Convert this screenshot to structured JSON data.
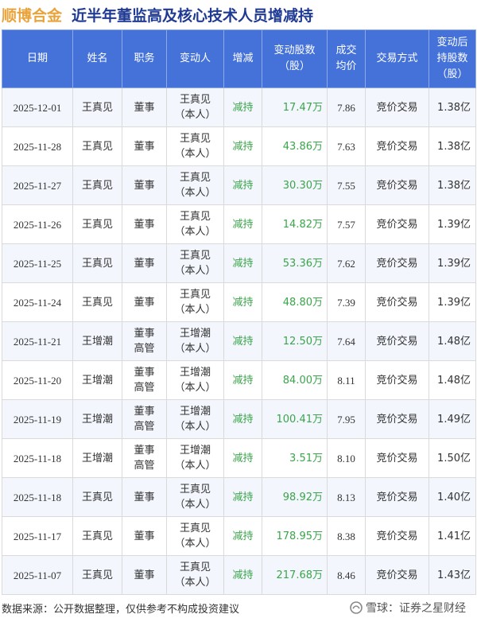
{
  "header": {
    "company": "顺博合金",
    "subject": "近半年董监高及核心技术人员增减持"
  },
  "table": {
    "columns": [
      "日期",
      "姓名",
      "职务",
      "变动人",
      "增减",
      "变动股数\n（股）",
      "成交\n均价",
      "交易方式",
      "变动后\n持股数\n（股）"
    ],
    "rows": [
      {
        "date": "2025-12-01",
        "name": "王真见",
        "role": "董事",
        "person": "王真见\n（本人）",
        "type": "减持",
        "shares": "17.47万",
        "price": "7.86",
        "method": "竞价交易",
        "balance": "1.38亿"
      },
      {
        "date": "2025-11-28",
        "name": "王真见",
        "role": "董事",
        "person": "王真见\n（本人）",
        "type": "减持",
        "shares": "43.86万",
        "price": "7.63",
        "method": "竞价交易",
        "balance": "1.38亿"
      },
      {
        "date": "2025-11-27",
        "name": "王真见",
        "role": "董事",
        "person": "王真见\n（本人）",
        "type": "减持",
        "shares": "30.30万",
        "price": "7.55",
        "method": "竞价交易",
        "balance": "1.38亿"
      },
      {
        "date": "2025-11-26",
        "name": "王真见",
        "role": "董事",
        "person": "王真见\n（本人）",
        "type": "减持",
        "shares": "14.82万",
        "price": "7.57",
        "method": "竞价交易",
        "balance": "1.39亿"
      },
      {
        "date": "2025-11-25",
        "name": "王真见",
        "role": "董事",
        "person": "王真见\n（本人）",
        "type": "减持",
        "shares": "53.36万",
        "price": "7.62",
        "method": "竞价交易",
        "balance": "1.39亿"
      },
      {
        "date": "2025-11-24",
        "name": "王真见",
        "role": "董事",
        "person": "王真见\n（本人）",
        "type": "减持",
        "shares": "48.80万",
        "price": "7.39",
        "method": "竞价交易",
        "balance": "1.39亿"
      },
      {
        "date": "2025-11-21",
        "name": "王增潮",
        "role": "董事\n高管",
        "person": "王增潮\n（本人）",
        "type": "减持",
        "shares": "12.50万",
        "price": "7.64",
        "method": "竞价交易",
        "balance": "1.48亿"
      },
      {
        "date": "2025-11-20",
        "name": "王增潮",
        "role": "董事\n高管",
        "person": "王增潮\n（本人）",
        "type": "减持",
        "shares": "84.00万",
        "price": "8.11",
        "method": "竞价交易",
        "balance": "1.48亿"
      },
      {
        "date": "2025-11-19",
        "name": "王增潮",
        "role": "董事\n高管",
        "person": "王增潮\n（本人）",
        "type": "减持",
        "shares": "100.41万",
        "price": "7.95",
        "method": "竞价交易",
        "balance": "1.49亿"
      },
      {
        "date": "2025-11-18",
        "name": "王增潮",
        "role": "董事\n高管",
        "person": "王增潮\n（本人）",
        "type": "减持",
        "shares": "3.51万",
        "price": "8.10",
        "method": "竞价交易",
        "balance": "1.50亿"
      },
      {
        "date": "2025-11-18",
        "name": "王真见",
        "role": "董事",
        "person": "王真见\n（本人）",
        "type": "减持",
        "shares": "98.92万",
        "price": "8.13",
        "method": "竞价交易",
        "balance": "1.40亿"
      },
      {
        "date": "2025-11-17",
        "name": "王真见",
        "role": "董事",
        "person": "王真见\n（本人）",
        "type": "减持",
        "shares": "178.95万",
        "price": "8.38",
        "method": "竞价交易",
        "balance": "1.41亿"
      },
      {
        "date": "2025-11-07",
        "name": "王真见",
        "role": "董事",
        "person": "王真见\n（本人）",
        "type": "减持",
        "shares": "217.68万",
        "price": "8.46",
        "method": "竞价交易",
        "balance": "1.43亿"
      }
    ]
  },
  "footer": {
    "source": "数据来源：公开数据整理，仅供参考不构成投资建议",
    "brand": "雪球：证券之星财经",
    "brand_icon": "snowball-icon"
  },
  "colors": {
    "header_bg": "#4472d8",
    "company": "#e8a33b",
    "subject": "#1f3a93",
    "decrease": "#3aa54a"
  }
}
